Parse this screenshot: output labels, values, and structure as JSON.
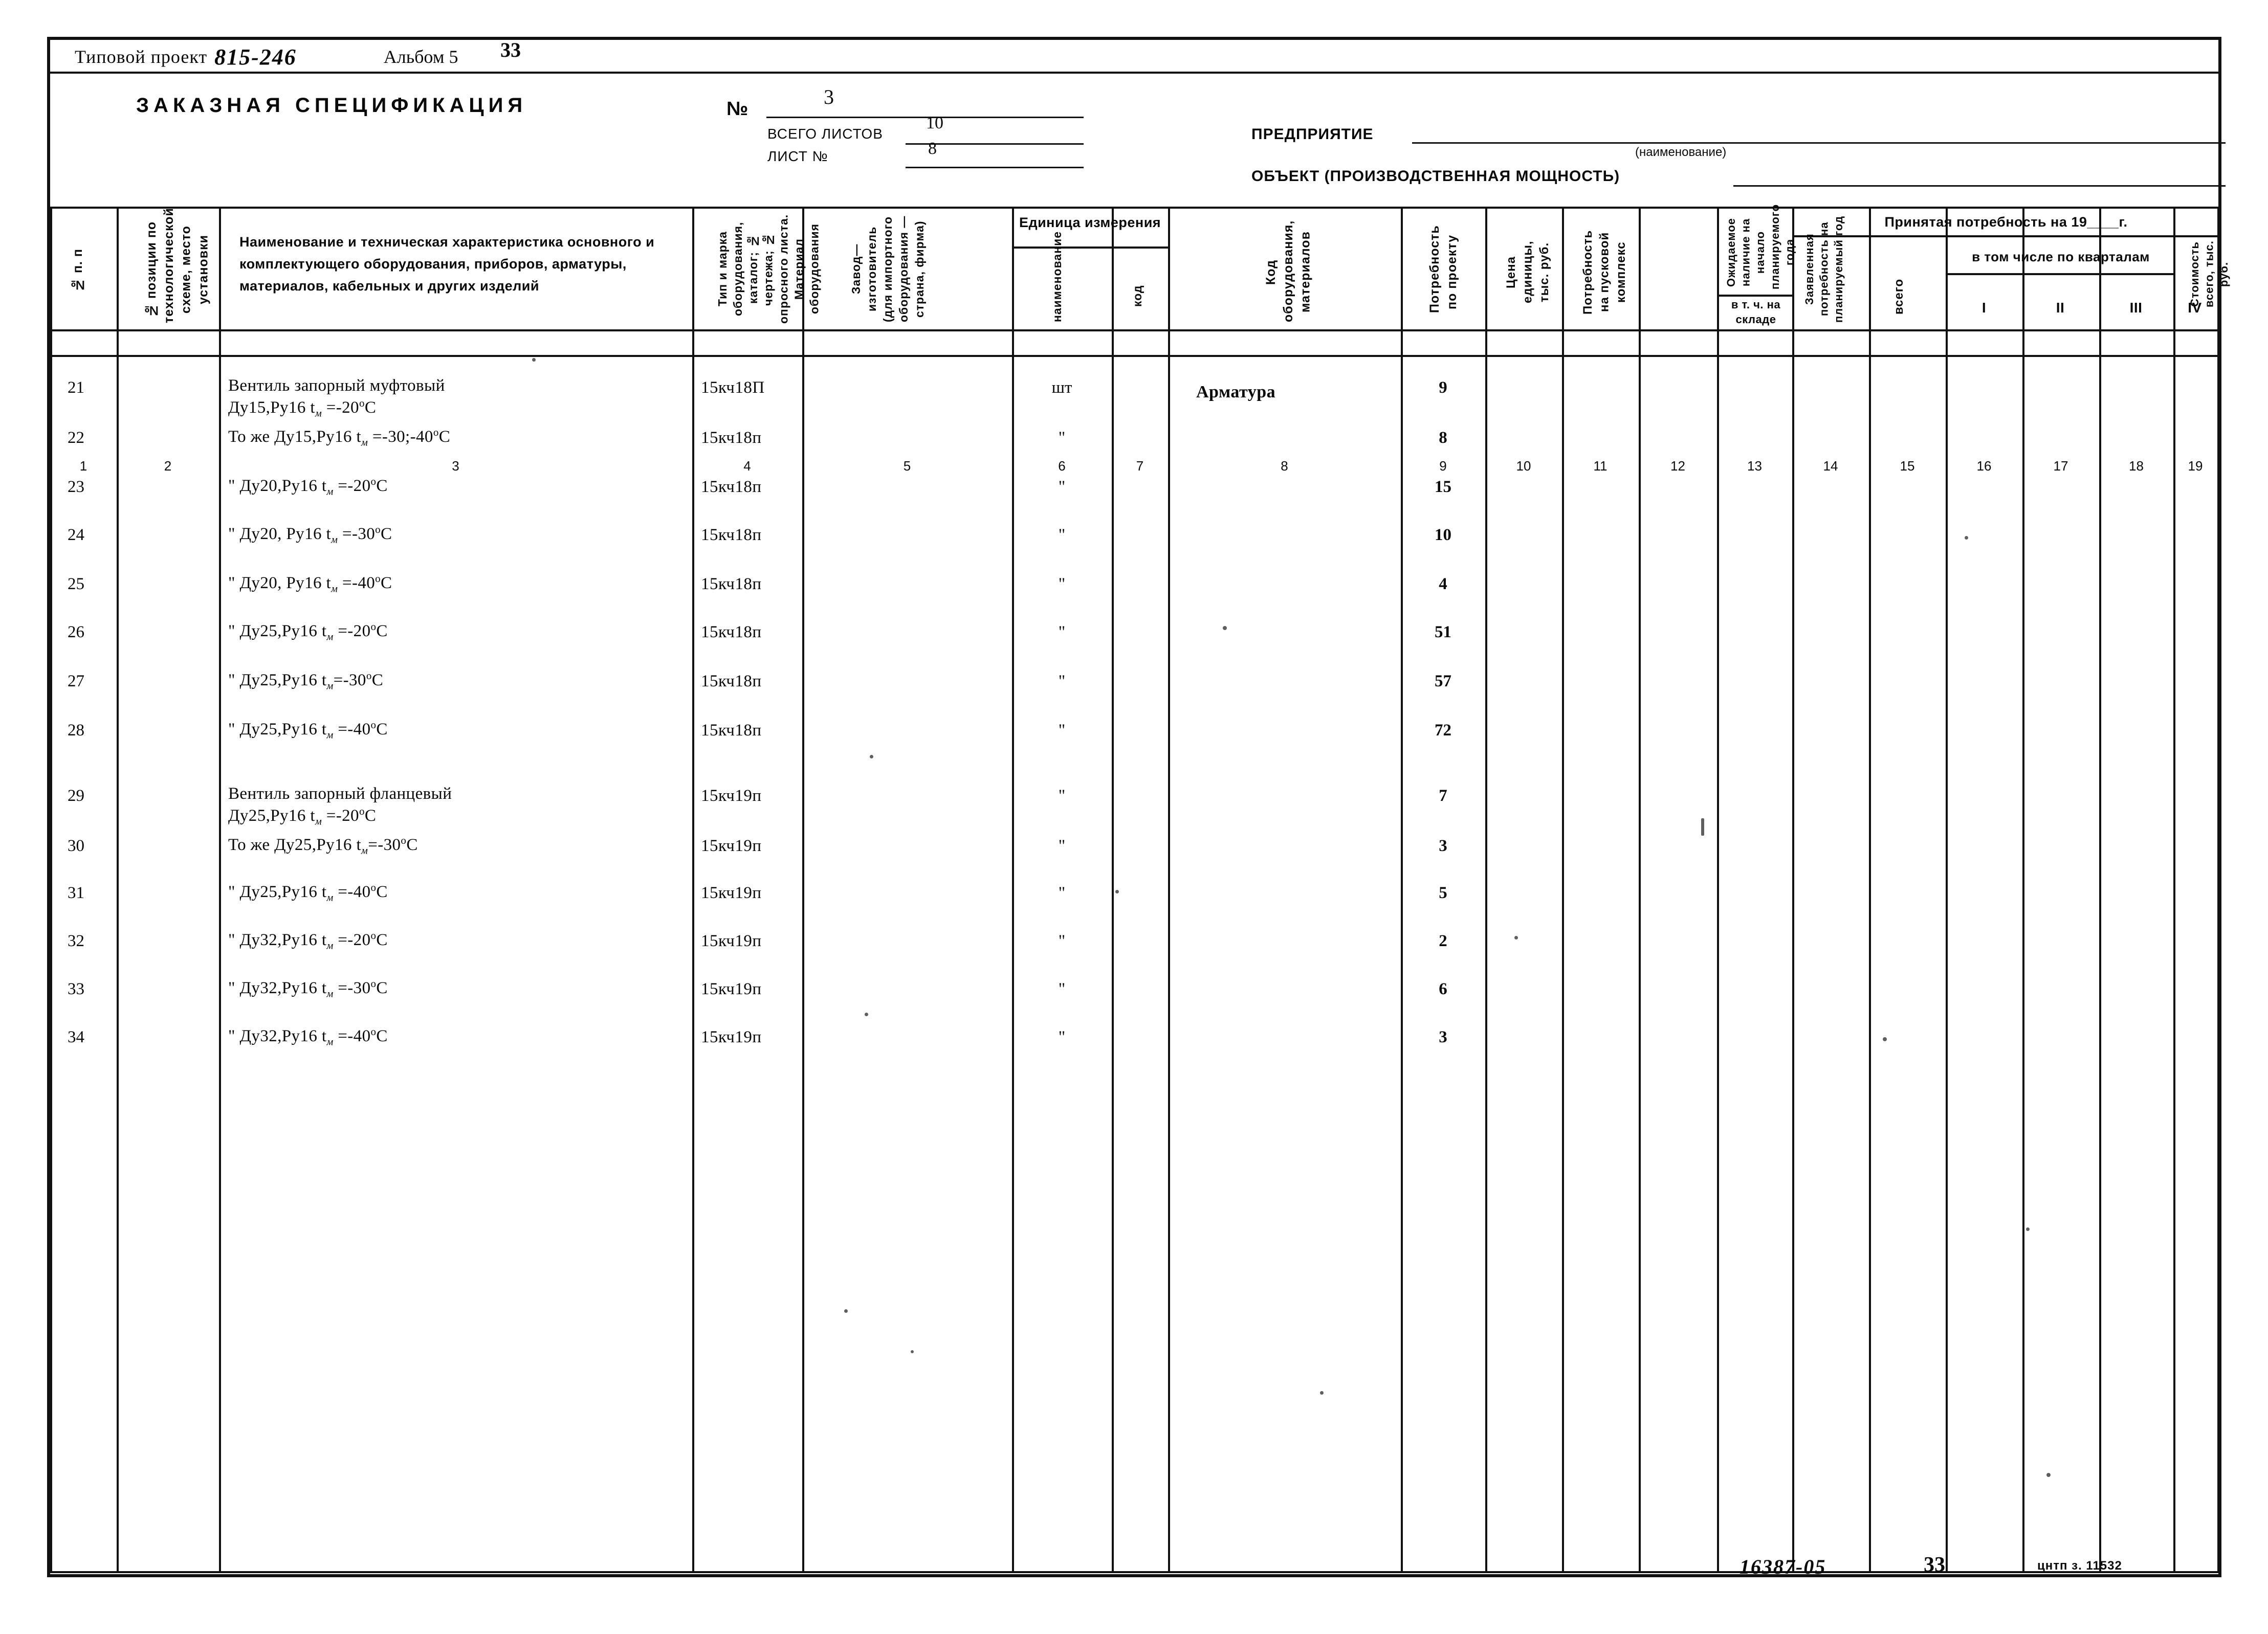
{
  "document": {
    "project_label": "Типовой проект",
    "project_number": "815-246",
    "album": "Альбом 5",
    "page_number_top": "33"
  },
  "spec_header": {
    "title": "ЗАКАЗНАЯ СПЕЦИФИКАЦИЯ",
    "number_label": "№",
    "number_value": "3",
    "total_sheets_label": "ВСЕГО ЛИСТОВ",
    "total_sheets_value": "10",
    "sheet_no_label": "ЛИСТ №",
    "sheet_no_value": "8",
    "enterprise_label": "ПРЕДПРИЯТИЕ",
    "enterprise_hint": "(наименование)",
    "object_label": "ОБЪЕКТ (ПРОИЗВОДСТВЕННАЯ МОЩНОСТЬ)"
  },
  "columns": {
    "c1": "№ п. п",
    "c2": "№ позиции по технологической схеме, место установки",
    "c3": "Наименование и техническая характеристика основного и комплектующего оборудования, приборов, арматуры, материалов, кабельных и других изделий",
    "c4": "Тип и марка оборудования, каталог; № чертежа; № опросного листа. Материал оборудования",
    "c5": "Завод—изготовитель (для импортного оборудования —страна, фирма)",
    "unit_group": "Единица измерения",
    "c6": "наименование",
    "c7": "код",
    "c8": "Код оборудования, материалов",
    "c9": "Потребность по проекту",
    "c10": "Цена единицы, тыс. руб.",
    "c11": "Потребность на пусковой комплекс",
    "c12": "Ожидаемое наличие на начало планируемого года",
    "c12b": "в т. ч. на складе",
    "c13": "Заявленная потребность на планируемый год",
    "accepted_group": "Принятая потребность на 19____г.",
    "c14": "всего",
    "quarters_group": "в том числе по кварталам",
    "c15": "I",
    "c16": "II",
    "c17": "III",
    "c18": "IV",
    "c19": "Стоимость всего, тыс. руб.",
    "numbers": [
      "1",
      "2",
      "3",
      "4",
      "5",
      "6",
      "7",
      "8",
      "9",
      "10",
      "11",
      "12",
      "13",
      "14",
      "15",
      "16",
      "17",
      "18",
      "19"
    ]
  },
  "section_label": "Арматура",
  "rows": [
    {
      "n": "21",
      "name_l1": "Вентиль запорный муфтовый",
      "name_l2": "Ду15,Ру16   t",
      "name_sub": "м",
      "name_l2b": " =-20",
      "deg": "о",
      "name_end": "С",
      "type": "15кч18П",
      "unit": "шт",
      "qty": "9"
    },
    {
      "n": "22",
      "name_l1": "",
      "name_l2": "То же Ду15,Ру16   t",
      "name_sub": "м",
      "name_l2b": " =-30;-40",
      "deg": "о",
      "name_end": "С",
      "type": "15кч18п",
      "unit": "\"",
      "qty": "8"
    },
    {
      "n": "23",
      "name_l1": "",
      "name_l2": "\"      Ду20,Ру16   t",
      "name_sub": "м",
      "name_l2b": " =-20",
      "deg": "о",
      "name_end": "С",
      "type": "15кч18п",
      "unit": "\"",
      "qty": "15"
    },
    {
      "n": "24",
      "name_l1": "",
      "name_l2": "\"      Ду20, Ру16  t",
      "name_sub": "м",
      "name_l2b": " =-30",
      "deg": "о",
      "name_end": "С",
      "type": "15кч18п",
      "unit": "\"",
      "qty": "10"
    },
    {
      "n": "25",
      "name_l1": "",
      "name_l2": "\"      Ду20, Ру16  t",
      "name_sub": "м",
      "name_l2b": " =-40",
      "deg": "о",
      "name_end": "С",
      "type": "15кч18п",
      "unit": "\"",
      "qty": "4"
    },
    {
      "n": "26",
      "name_l1": "",
      "name_l2": "\"      Ду25,Ру16   t",
      "name_sub": "м",
      "name_l2b": " =-20",
      "deg": "о",
      "name_end": "С",
      "type": "15кч18п",
      "unit": "\"",
      "qty": "51"
    },
    {
      "n": "27",
      "name_l1": "",
      "name_l2": "\"      Ду25,Ру16   t",
      "name_sub": "м",
      "name_l2b": "=-30",
      "deg": "о",
      "name_end": "С",
      "type": "15кч18п",
      "unit": "\"",
      "qty": "57"
    },
    {
      "n": "28",
      "name_l1": "",
      "name_l2": "\"      Ду25,Ру16   t",
      "name_sub": "м",
      "name_l2b": " =-40",
      "deg": "о",
      "name_end": "С",
      "type": "15кч18п",
      "unit": "\"",
      "qty": "72"
    },
    {
      "n": "29",
      "name_l1": "Вентиль запорный фланцевый",
      "name_l2": "Ду25,Ру16    t",
      "name_sub": "м",
      "name_l2b": " =-20",
      "deg": "о",
      "name_end": "С",
      "type": "15кч19п",
      "unit": "\"",
      "qty": "7"
    },
    {
      "n": "30",
      "name_l1": "",
      "name_l2": "То же Ду25,Ру16  t",
      "name_sub": "м",
      "name_l2b": "=-30",
      "deg": "о",
      "name_end": "С",
      "type": "15кч19п",
      "unit": "\"",
      "qty": "3"
    },
    {
      "n": "31",
      "name_l1": "",
      "name_l2": "\"      Ду25,Ру16   t",
      "name_sub": "м",
      "name_l2b": " =-40",
      "deg": "о",
      "name_end": "С",
      "type": "15кч19п",
      "unit": "\"",
      "qty": "5"
    },
    {
      "n": "32",
      "name_l1": "",
      "name_l2": "\"      Ду32,Ру16   t",
      "name_sub": "м",
      "name_l2b": " =-20",
      "deg": "о",
      "name_end": "С",
      "type": "15кч19п",
      "unit": "\"",
      "qty": "2"
    },
    {
      "n": "33",
      "name_l1": "",
      "name_l2": "\"      Ду32,Ру16   t",
      "name_sub": "м",
      "name_l2b": " =-30",
      "deg": "о",
      "name_end": "С",
      "type": "15кч19п",
      "unit": "\"",
      "qty": "6"
    },
    {
      "n": "34",
      "name_l1": "",
      "name_l2": "\"      Ду32,Ру16   t",
      "name_sub": "м",
      "name_l2b": " =-40",
      "deg": "о",
      "name_end": "С",
      "type": "15кч19п",
      "unit": "\"",
      "qty": "3"
    }
  ],
  "footer": {
    "code": "16387-05",
    "page": "33",
    "stamp": "цнтп з. 11532"
  }
}
